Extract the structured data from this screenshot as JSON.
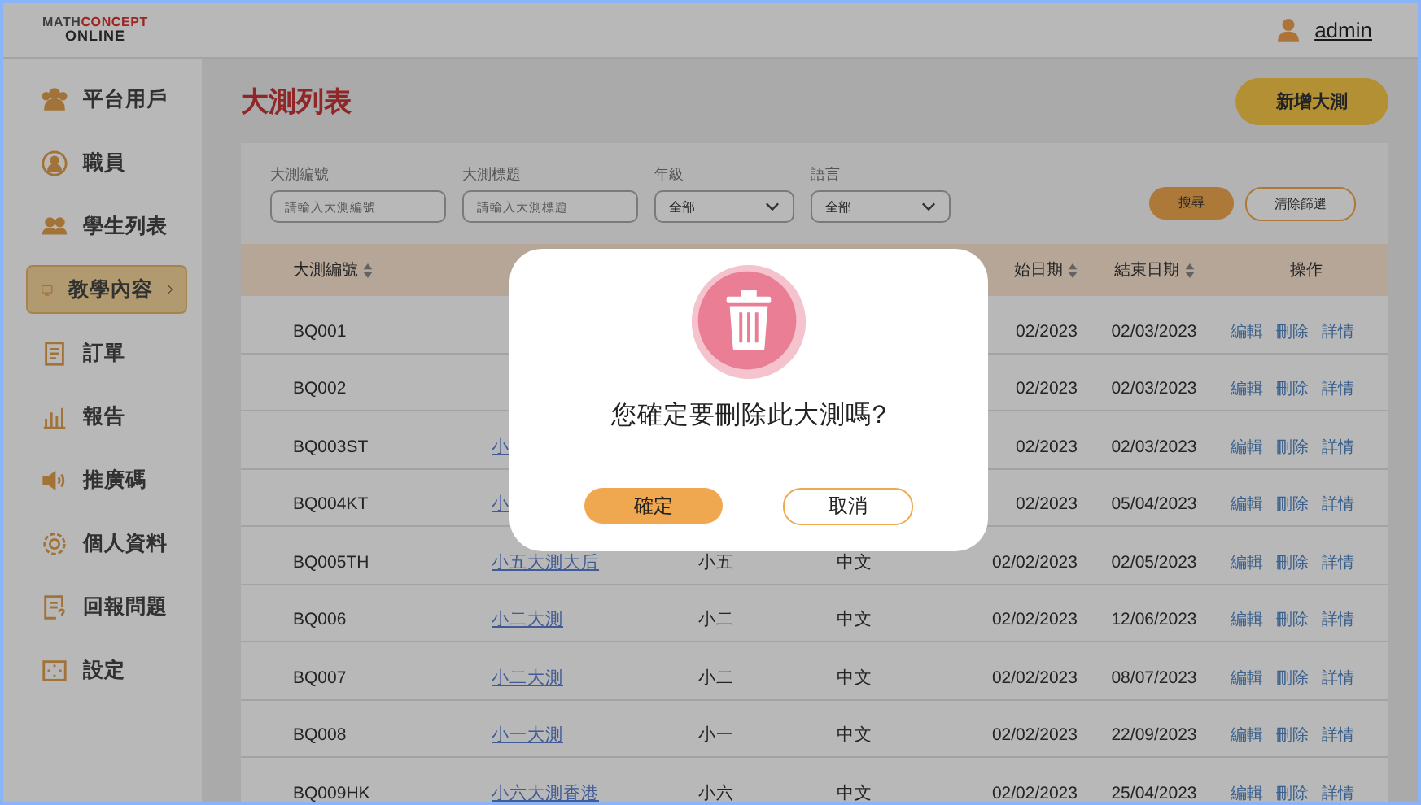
{
  "header": {
    "logo": {
      "line1": [
        "MATH",
        "CONCEPT"
      ],
      "line2": "ONLINE"
    },
    "user": "admin"
  },
  "sidebar": {
    "items": [
      {
        "label": "平台用戶",
        "selected": false
      },
      {
        "label": "職員",
        "selected": false
      },
      {
        "label": "學生列表",
        "selected": false
      },
      {
        "label": "教學內容",
        "selected": true
      },
      {
        "label": "訂單",
        "selected": false
      },
      {
        "label": "報告",
        "selected": false
      },
      {
        "label": "推廣碼",
        "selected": false
      },
      {
        "label": "個人資料",
        "selected": false
      },
      {
        "label": "回報問題",
        "selected": false
      },
      {
        "label": "設定",
        "selected": false
      }
    ]
  },
  "page": {
    "title": "大測列表",
    "add_button": "新增大測"
  },
  "filters": [
    {
      "kind": "text",
      "label": "大測編號",
      "placeholder": "請輸入大測編號"
    },
    {
      "kind": "text",
      "label": "大測標題",
      "placeholder": "請輸入大測標題"
    },
    {
      "kind": "select",
      "label": "年級",
      "value": "全部"
    },
    {
      "kind": "select",
      "label": "語言",
      "value": "全部"
    }
  ],
  "filter_buttons": {
    "search": "搜尋",
    "clear": "清除篩選"
  },
  "table": {
    "columns": [
      {
        "label": "大測編號",
        "sortable": true
      },
      null,
      null,
      null,
      {
        "label": "始日期",
        "sortable": true
      },
      {
        "label": "結束日期",
        "sortable": true
      },
      {
        "label": "操作",
        "sortable": false
      }
    ],
    "rows": [
      {
        "id": "BQ001",
        "title": null,
        "grade": null,
        "language": null,
        "start": "02/2023",
        "end": "02/03/2023",
        "actions": [
          "編輯",
          "刪除",
          "詳情"
        ]
      },
      {
        "id": "BQ002",
        "title": null,
        "grade": null,
        "language": null,
        "start": "02/2023",
        "end": "02/03/2023",
        "actions": [
          "編輯",
          "刪除",
          "詳情"
        ]
      },
      {
        "id": "BQ003ST",
        "title": "小",
        "grade": null,
        "language": null,
        "start": "02/2023",
        "end": "02/03/2023",
        "actions": [
          "編輯",
          "刪除",
          "詳情"
        ]
      },
      {
        "id": "BQ004KT",
        "title": "小",
        "grade": null,
        "language": null,
        "start": "02/2023",
        "end": "05/04/2023",
        "actions": [
          "編輯",
          "刪除",
          "詳情"
        ]
      },
      {
        "id": "BQ005TH",
        "title": "小五大測大后",
        "grade": "小五",
        "language": "中文",
        "start": "02/02/2023",
        "end": "02/05/2023",
        "actions": [
          "編輯",
          "刪除",
          "詳情"
        ]
      },
      {
        "id": "BQ006",
        "title": "小二大測",
        "grade": "小二",
        "language": "中文",
        "start": "02/02/2023",
        "end": "12/06/2023",
        "actions": [
          "編輯",
          "刪除",
          "詳情"
        ]
      },
      {
        "id": "BQ007",
        "title": "小二大測",
        "grade": "小二",
        "language": "中文",
        "start": "02/02/2023",
        "end": "08/07/2023",
        "actions": [
          "編輯",
          "刪除",
          "詳情"
        ]
      },
      {
        "id": "BQ008",
        "title": "小一大測",
        "grade": "小一",
        "language": "中文",
        "start": "02/02/2023",
        "end": "22/09/2023",
        "actions": [
          "編輯",
          "刪除",
          "詳情"
        ]
      },
      {
        "id": "BQ009HK",
        "title": "小六大測香港",
        "grade": "小六",
        "language": "中文",
        "start": "02/02/2023",
        "end": "25/04/2023",
        "actions": [
          "編輯",
          "刪除",
          "詳情"
        ]
      }
    ]
  },
  "dialog": {
    "open": true,
    "message": "您確定要刪除此大測嗎?",
    "confirm": "確定",
    "cancel": "取消"
  }
}
